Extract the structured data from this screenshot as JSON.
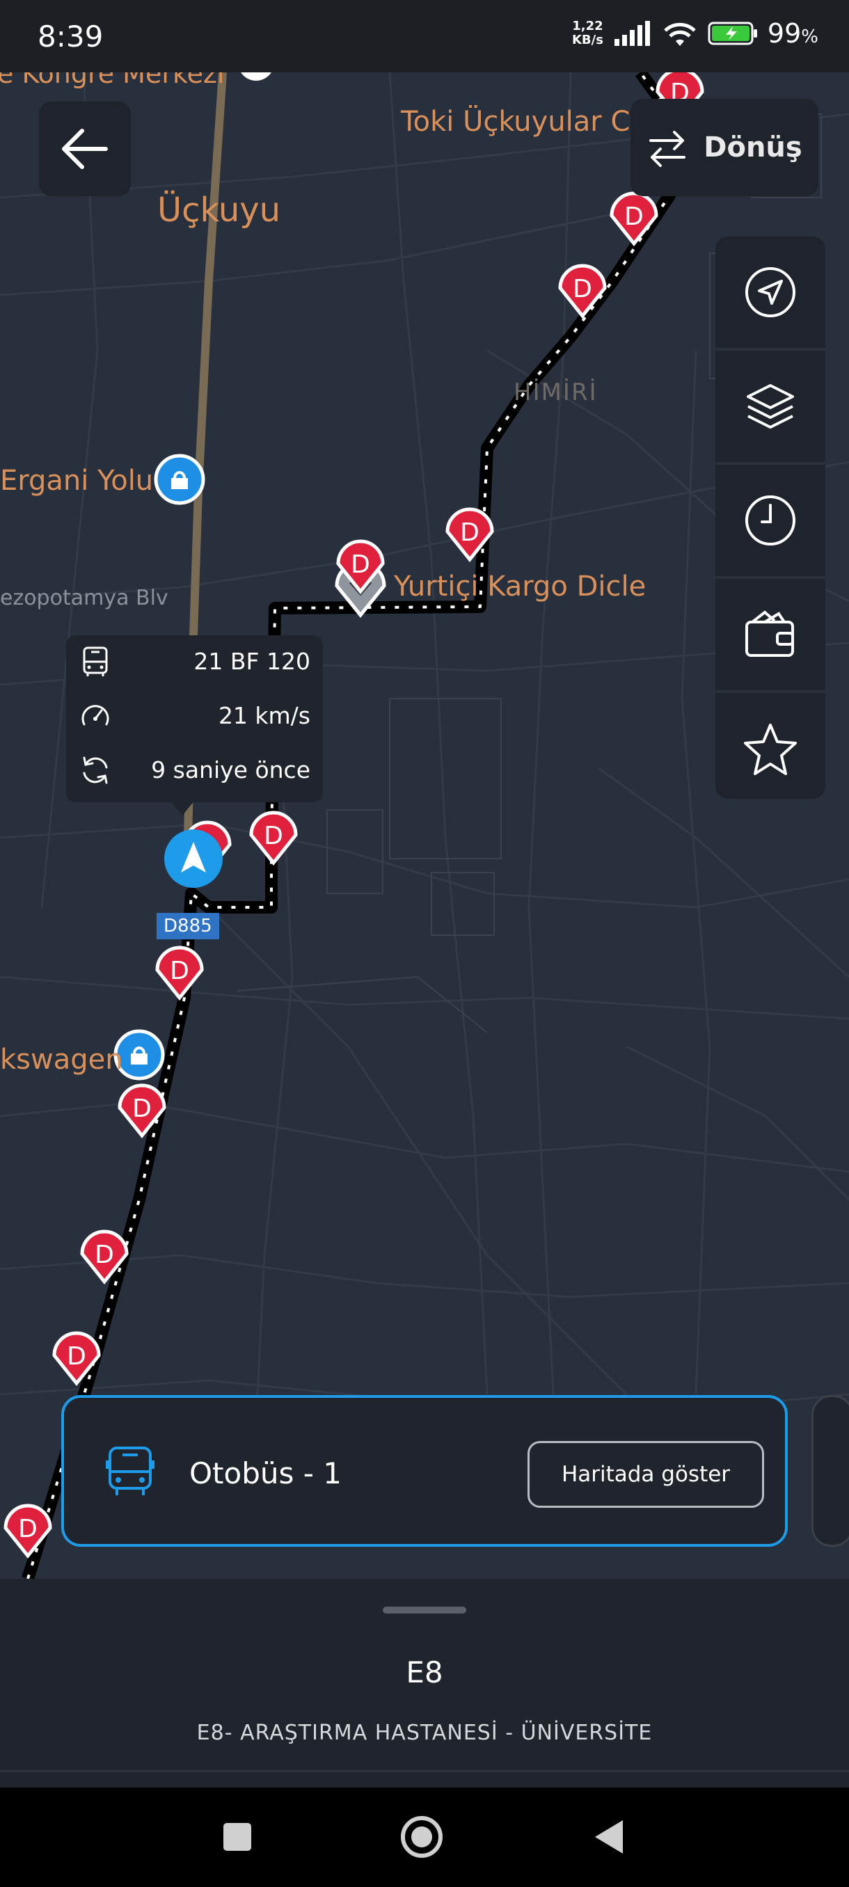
{
  "status_bar": {
    "time": "8:39",
    "net_speed_value": "1,22",
    "net_speed_unit": "KB/s",
    "battery_percent": "99",
    "battery_percent_sign": "%"
  },
  "map": {
    "labels": {
      "kongre": "e Kongre Merkezi",
      "toki": "Toki Üçkuyular C",
      "uckuyu": "Üçkuyu",
      "himiri": "HİMİRİ",
      "ergani": "Ergani Yolu",
      "mezopotamya": "ezopotamya Blv",
      "yurtici": "Yurtiçi Kargo Dicle",
      "volkswagen": "kswagen",
      "road_badge": "D885"
    },
    "stop_marker_letter": "D",
    "colors": {
      "map_bg": "#29303d",
      "road": "#353d4a",
      "highway": "#7a6b55",
      "stop_red": "#e0213d",
      "accent_blue": "#1e9be9",
      "poi_blue": "#1f8fe5",
      "label_orange": "#d9905a"
    }
  },
  "buttons": {
    "back_icon": "arrow-left-icon",
    "donus_label": "Dönüş",
    "donus_icon": "swap-arrows-icon"
  },
  "toolbar": {
    "items": [
      {
        "icon": "navigation-arrow-icon"
      },
      {
        "icon": "layers-icon"
      },
      {
        "icon": "clock-icon"
      },
      {
        "icon": "wallet-icon"
      },
      {
        "icon": "star-icon"
      }
    ]
  },
  "vehicle_popup": {
    "plate": "21 BF 120",
    "speed": "21 km/s",
    "updated": "9 saniye önce"
  },
  "bus_card": {
    "title": "Otobüs - 1",
    "show_on_map_label": "Haritada göster"
  },
  "bottom_sheet": {
    "route_code": "E8",
    "route_name": "E8- ARAŞTIRMA HASTANESİ - ÜNİVERSİTE"
  }
}
